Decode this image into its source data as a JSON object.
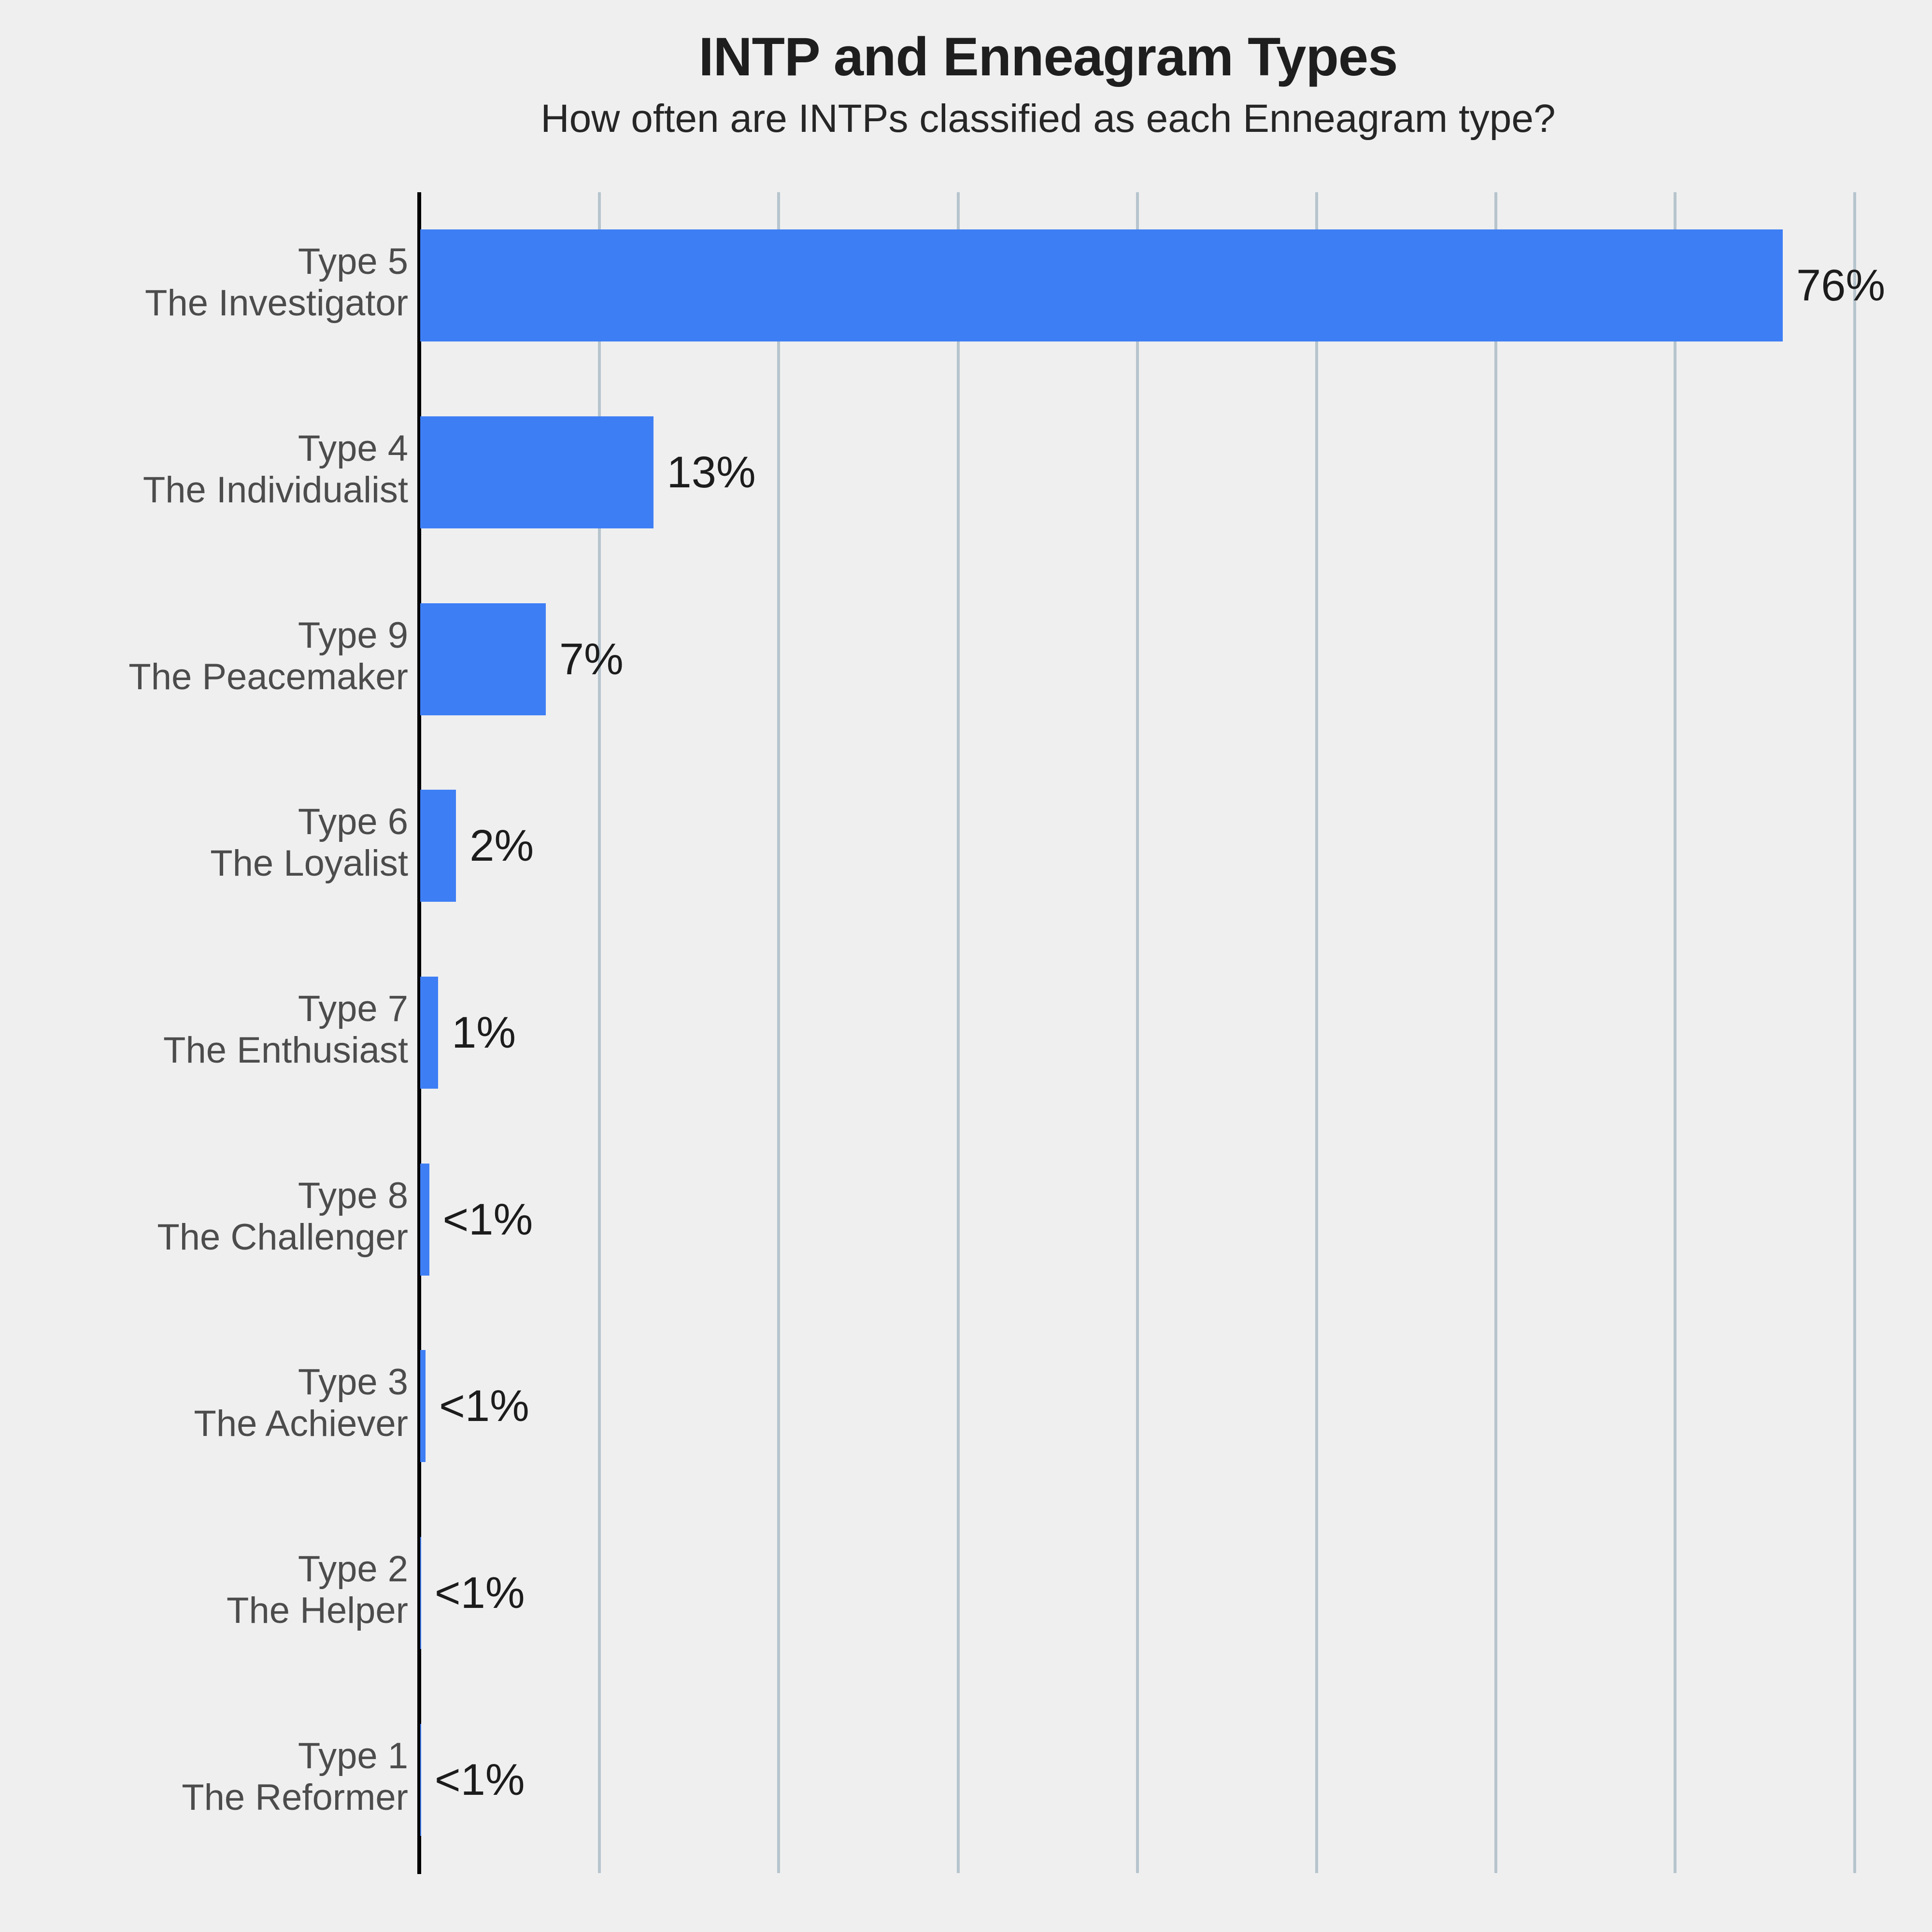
{
  "chart_data": {
    "type": "bar",
    "orientation": "horizontal",
    "title": "INTP and Enneagram Types",
    "subtitle": "How often are INTPs classified as each Enneagram type?",
    "xlabel": "",
    "ylabel": "",
    "xlim": [
      0,
      84
    ],
    "grid": true,
    "gridline_values": [
      10,
      20,
      30,
      40,
      50,
      60,
      70,
      80
    ],
    "legend": null,
    "bar_color": "#3d7ef5",
    "background_color": "#efefef",
    "axis_color": "#000000",
    "gridline_color": "#b6c4cd",
    "tick_label_color": "#4c4c4c",
    "value_label_color": "#1c1c1c",
    "categories": [
      "Type 5\nThe Investigator",
      "Type 4\nThe Individualist",
      "Type 9\nThe Peacemaker",
      "Type 6\nThe Loyalist",
      "Type 7\nThe Enthusiast",
      "Type 8\nThe Challenger",
      "Type 3\nThe Achiever",
      "Type 2\nThe Helper",
      "Type 1\nThe Reformer"
    ],
    "values": [
      76,
      13,
      7,
      2,
      1,
      0.5,
      0.3,
      0.05,
      0.05
    ],
    "value_labels": [
      "76%",
      "13%",
      "7%",
      "2%",
      "1%",
      "<1%",
      "<1%",
      "<1%",
      "<1%"
    ],
    "bars": [
      {
        "type_line": "Type 5",
        "name_line": "The Investigator",
        "value": 76,
        "label": "76%"
      },
      {
        "type_line": "Type 4",
        "name_line": "The Individualist",
        "value": 13,
        "label": "13%"
      },
      {
        "type_line": "Type 9",
        "name_line": "The Peacemaker",
        "value": 7,
        "label": "7%"
      },
      {
        "type_line": "Type 6",
        "name_line": "The Loyalist",
        "value": 2,
        "label": "2%"
      },
      {
        "type_line": "Type 7",
        "name_line": "The Enthusiast",
        "value": 1,
        "label": "1%"
      },
      {
        "type_line": "Type 8",
        "name_line": "The Challenger",
        "value": 0.5,
        "label": "<1%"
      },
      {
        "type_line": "Type 3",
        "name_line": "The Achiever",
        "value": 0.3,
        "label": "<1%"
      },
      {
        "type_line": "Type 2",
        "name_line": "The Helper",
        "value": 0.05,
        "label": "<1%"
      },
      {
        "type_line": "Type 1",
        "name_line": "The Reformer",
        "value": 0.05,
        "label": "<1%"
      }
    ]
  }
}
